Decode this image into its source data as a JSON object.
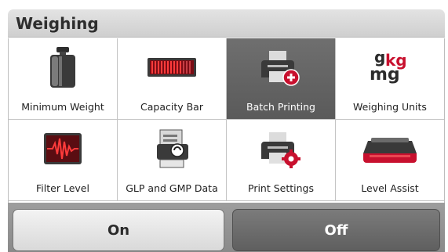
{
  "header": {
    "title": "Weighing"
  },
  "tiles": [
    {
      "label": "Minimum Weight",
      "icon": "weight-icon"
    },
    {
      "label": "Capacity Bar",
      "icon": "capacity-bar-icon"
    },
    {
      "label": "Batch Printing",
      "icon": "printer-add-icon",
      "selected": true
    },
    {
      "label": "Weighing Units",
      "icon": "units-icon",
      "units": {
        "g": "g",
        "kg": "kg",
        "mg": "mg"
      }
    },
    {
      "label": "Filter Level",
      "icon": "filter-wave-icon"
    },
    {
      "label": "GLP and GMP Data",
      "icon": "glp-gmp-icon"
    },
    {
      "label": "Print Settings",
      "icon": "printer-settings-icon"
    },
    {
      "label": "Level Assist",
      "icon": "balance-icon"
    }
  ],
  "footer": {
    "on_label": "On",
    "off_label": "Off"
  },
  "colors": {
    "accent_red": "#c8102e",
    "selected_tile": "#666666"
  }
}
